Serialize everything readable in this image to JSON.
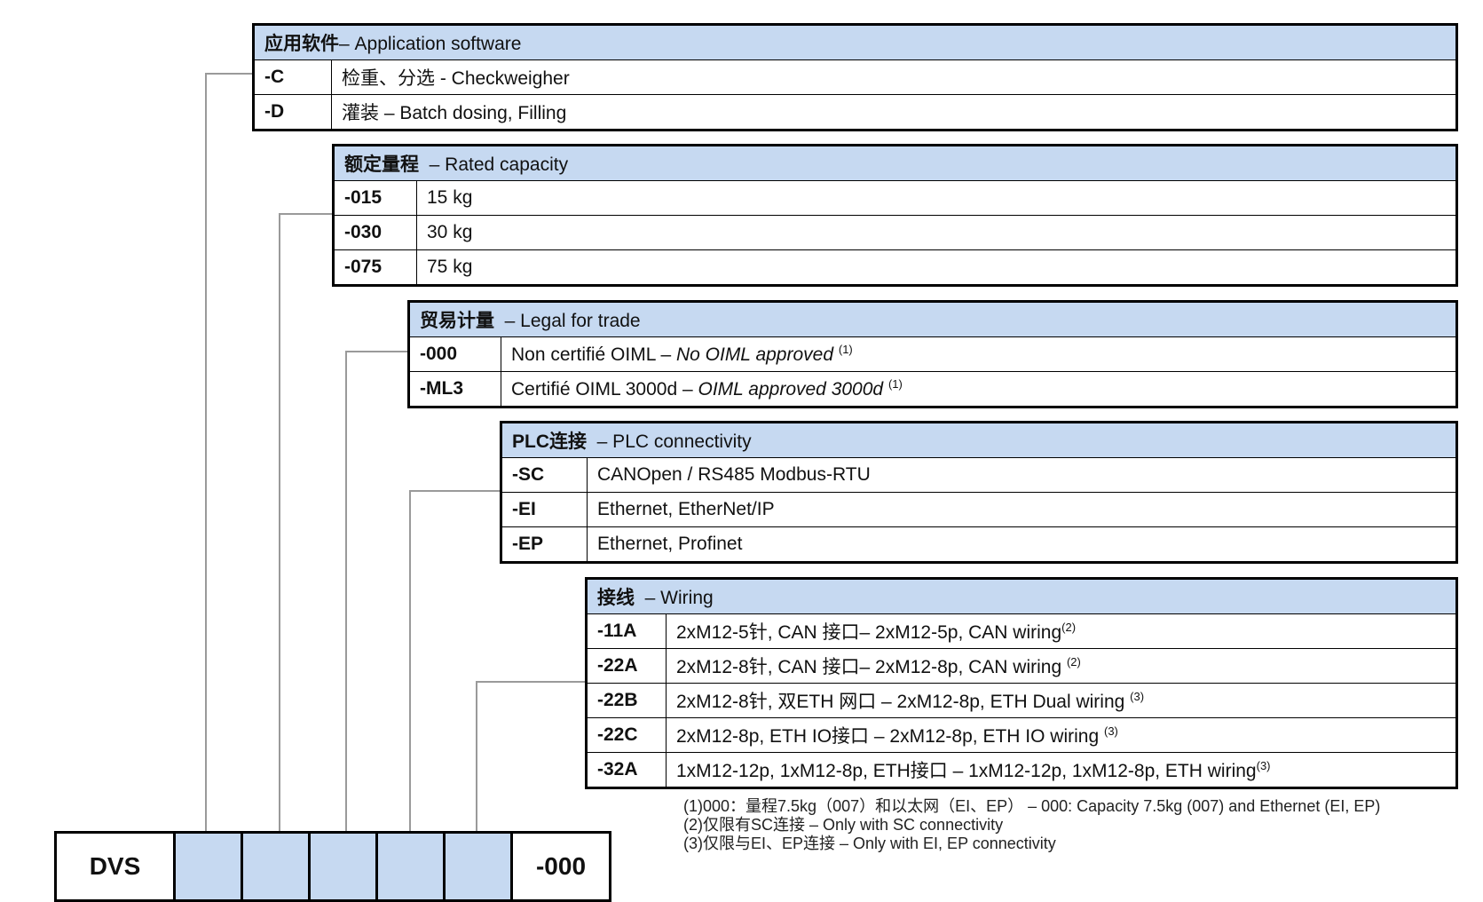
{
  "app": {
    "title": "应用软件",
    "subtitle": "– Application software",
    "rows": [
      {
        "code": "-C",
        "desc": "检重、分选  - Checkweigher"
      },
      {
        "code": "-D",
        "desc": "灌装  – Batch dosing, Filling"
      }
    ]
  },
  "capacity": {
    "title": "额定量程",
    "subtitle": "– Rated capacity",
    "rows": [
      {
        "code": "-015",
        "desc": "15 kg"
      },
      {
        "code": "-030",
        "desc": "30 kg"
      },
      {
        "code": "-075",
        "desc": "75 kg"
      }
    ]
  },
  "trade": {
    "title": "贸易计量",
    "subtitle": "– Legal for trade",
    "rows": [
      {
        "code": "-000",
        "desc": "Non certifié OIML – ",
        "desc_italic": "No OIML approved",
        "note": "(1)"
      },
      {
        "code": "-ML3",
        "desc": "Certifié OIML 3000d – ",
        "desc_italic": "OIML approved 3000d",
        "note": "(1)"
      }
    ]
  },
  "plc": {
    "title": "PLC连接",
    "subtitle": "– PLC connectivity",
    "rows": [
      {
        "code": "-SC",
        "desc": "CANOpen / RS485 Modbus-RTU"
      },
      {
        "code": "-EI",
        "desc": "Ethernet, EtherNet/IP"
      },
      {
        "code": "-EP",
        "desc": "Ethernet, Profinet"
      }
    ]
  },
  "wiring": {
    "title": "接线",
    "subtitle": "– Wiring",
    "rows": [
      {
        "code": "-11A",
        "desc": "2xM12-5针, CAN  接口– 2xM12-5p, CAN wiring",
        "note": "(2)"
      },
      {
        "code": "-22A",
        "desc": "2xM12-8针, CAN  接口– 2xM12-8p, CAN wiring ",
        "note": "(2)"
      },
      {
        "code": "-22B",
        "desc": "2xM12-8针, 双ETH  网口  – 2xM12-8p, ETH Dual wiring ",
        "note": "(3)"
      },
      {
        "code": "-22C",
        "desc": "2xM12-8p, ETH IO接口  – 2xM12-8p, ETH IO wiring ",
        "note": "(3)"
      },
      {
        "code": "-32A",
        "desc": "1xM12-12p, 1xM12-8p, ETH接口  – 1xM12-12p, 1xM12-8p, ETH wiring",
        "note": "(3)"
      }
    ]
  },
  "model": {
    "prefix": "DVS",
    "suffix": "-000"
  },
  "notes": [
    "(1)000：量程7.5kg（007）和以太网（EI、EP）  – 000: Capacity  7.5kg (007) and Ethernet (EI, EP)",
    "(2)仅限有SC连接  – Only  with  SC connectivity",
    "(3)仅限与EI、EP连接  – Only  with  EI, EP connectivity"
  ],
  "colors": {
    "header_fill": "#c6d9f1",
    "connector_line": "#9a9a9a"
  }
}
